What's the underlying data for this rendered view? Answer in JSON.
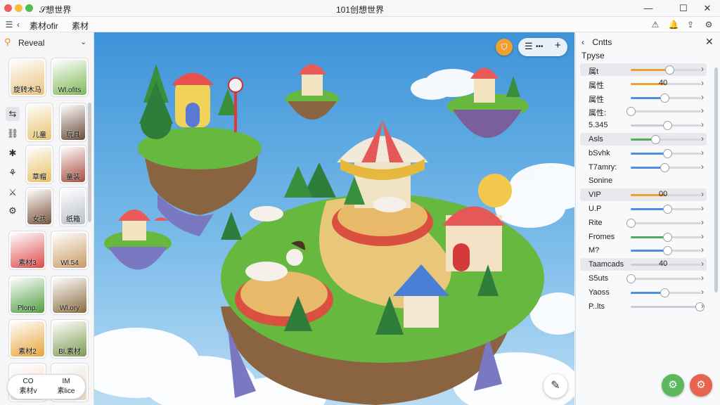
{
  "titlebar": {
    "app_title": "𝒮想世界",
    "window_title": "101创想世界",
    "min": "—",
    "max": "☐",
    "close": "✕"
  },
  "menubar": {
    "items": [
      "素材ofir",
      "素材"
    ],
    "hamburger": "☰",
    "back": "‹"
  },
  "sidebar": {
    "header": "Reveal",
    "tiles": [
      {
        "caption": "旋转木马",
        "color": "#e9c27a"
      },
      {
        "caption": "Wl.ofits",
        "color": "#7cb855"
      },
      {
        "caption": "儿童",
        "color": "#e7c36b"
      },
      {
        "caption": "玩具",
        "color": "#6a4a36"
      },
      {
        "caption": "草帽",
        "color": "#e6c062"
      },
      {
        "caption": "童装",
        "color": "#a84a3d"
      },
      {
        "caption": "女孩",
        "color": "#7a5238"
      },
      {
        "caption": "纸箱",
        "color": "#b9bec6"
      },
      {
        "caption": "素材3",
        "color": "#e04848"
      },
      {
        "caption": "Wl.54",
        "color": "#c89a64"
      },
      {
        "caption": "Plonp.",
        "color": "#4f9e3e"
      },
      {
        "caption": "Wl.ory",
        "color": "#8a6a3c"
      },
      {
        "caption": "素材2",
        "color": "#e8a33a"
      },
      {
        "caption": "Bl.素材",
        "color": "#7c9a50"
      },
      {
        "caption": "",
        "color": "#f4d7c4"
      },
      {
        "caption": "",
        "color": "#e9d6c5"
      }
    ],
    "bottom": [
      {
        "top": "CO",
        "bottom": "素材v"
      },
      {
        "top": "IM",
        "bottom": "素lice"
      }
    ]
  },
  "canvas": {
    "toolbar_icon": "≡ ••• +"
  },
  "panel": {
    "title": "Cntts",
    "subtitle": "Tpyse",
    "properties": [
      {
        "name": "属t",
        "value": "",
        "level": 0.55,
        "color": "#f0a030",
        "highlight": true
      },
      {
        "name": "属性",
        "value": "40",
        "level": 0.5,
        "color": "#f0a030",
        "highlight": false
      },
      {
        "name": "属性",
        "value": "",
        "level": 0.48,
        "color": "#4a8ee6",
        "highlight": false
      },
      {
        "name": "属性:",
        "value": "",
        "level": 0,
        "color": "#4a8ee6",
        "highlight": false
      },
      {
        "name": "5.345",
        "value": "",
        "level": 0.52,
        "color": "#c9cdd2",
        "highlight": false
      },
      {
        "name": "Asls",
        "value": "",
        "level": 0.35,
        "color": "#58a85c",
        "highlight": true
      },
      {
        "name": "bSvhk",
        "value": "",
        "level": 0.52,
        "color": "#4a8ee6",
        "highlight": false
      },
      {
        "name": "T7amry:",
        "value": "",
        "level": 0.48,
        "color": "#4a8ee6",
        "highlight": false
      },
      {
        "name": "Sonine",
        "value": "",
        "level": null,
        "color": "",
        "highlight": false
      },
      {
        "name": "VIP",
        "value": "00",
        "level": 0.5,
        "color": "#f0a030",
        "highlight": true
      },
      {
        "name": "U.P",
        "value": "",
        "level": 0.52,
        "color": "#4a8ee6",
        "highlight": false
      },
      {
        "name": "Rite",
        "value": "",
        "level": 0,
        "color": "#4a8ee6",
        "highlight": false
      },
      {
        "name": "Fromes",
        "value": "",
        "level": 0.52,
        "color": "#58a85c",
        "highlight": false
      },
      {
        "name": "M?",
        "value": "",
        "level": 0.52,
        "color": "#4a8ee6",
        "highlight": false
      },
      {
        "name": "Taamcads",
        "value": "40",
        "level": 0.5,
        "color": "#c9cdd2",
        "highlight": true
      },
      {
        "name": "S5uts",
        "value": "",
        "level": 0,
        "color": "#4a8ee6",
        "highlight": false
      },
      {
        "name": "Yaoss",
        "value": "",
        "level": 0.48,
        "color": "#4a8ee6",
        "highlight": false
      },
      {
        "name": "P..lts",
        "value": "",
        "level": 0.98,
        "color": "#c9cdd2",
        "highlight": false
      }
    ]
  },
  "colors": {
    "accent_orange": "#f0a030",
    "accent_blue": "#4a8ee6",
    "accent_green": "#58a85c",
    "button_green": "#5cb85c",
    "button_red": "#e86450"
  }
}
